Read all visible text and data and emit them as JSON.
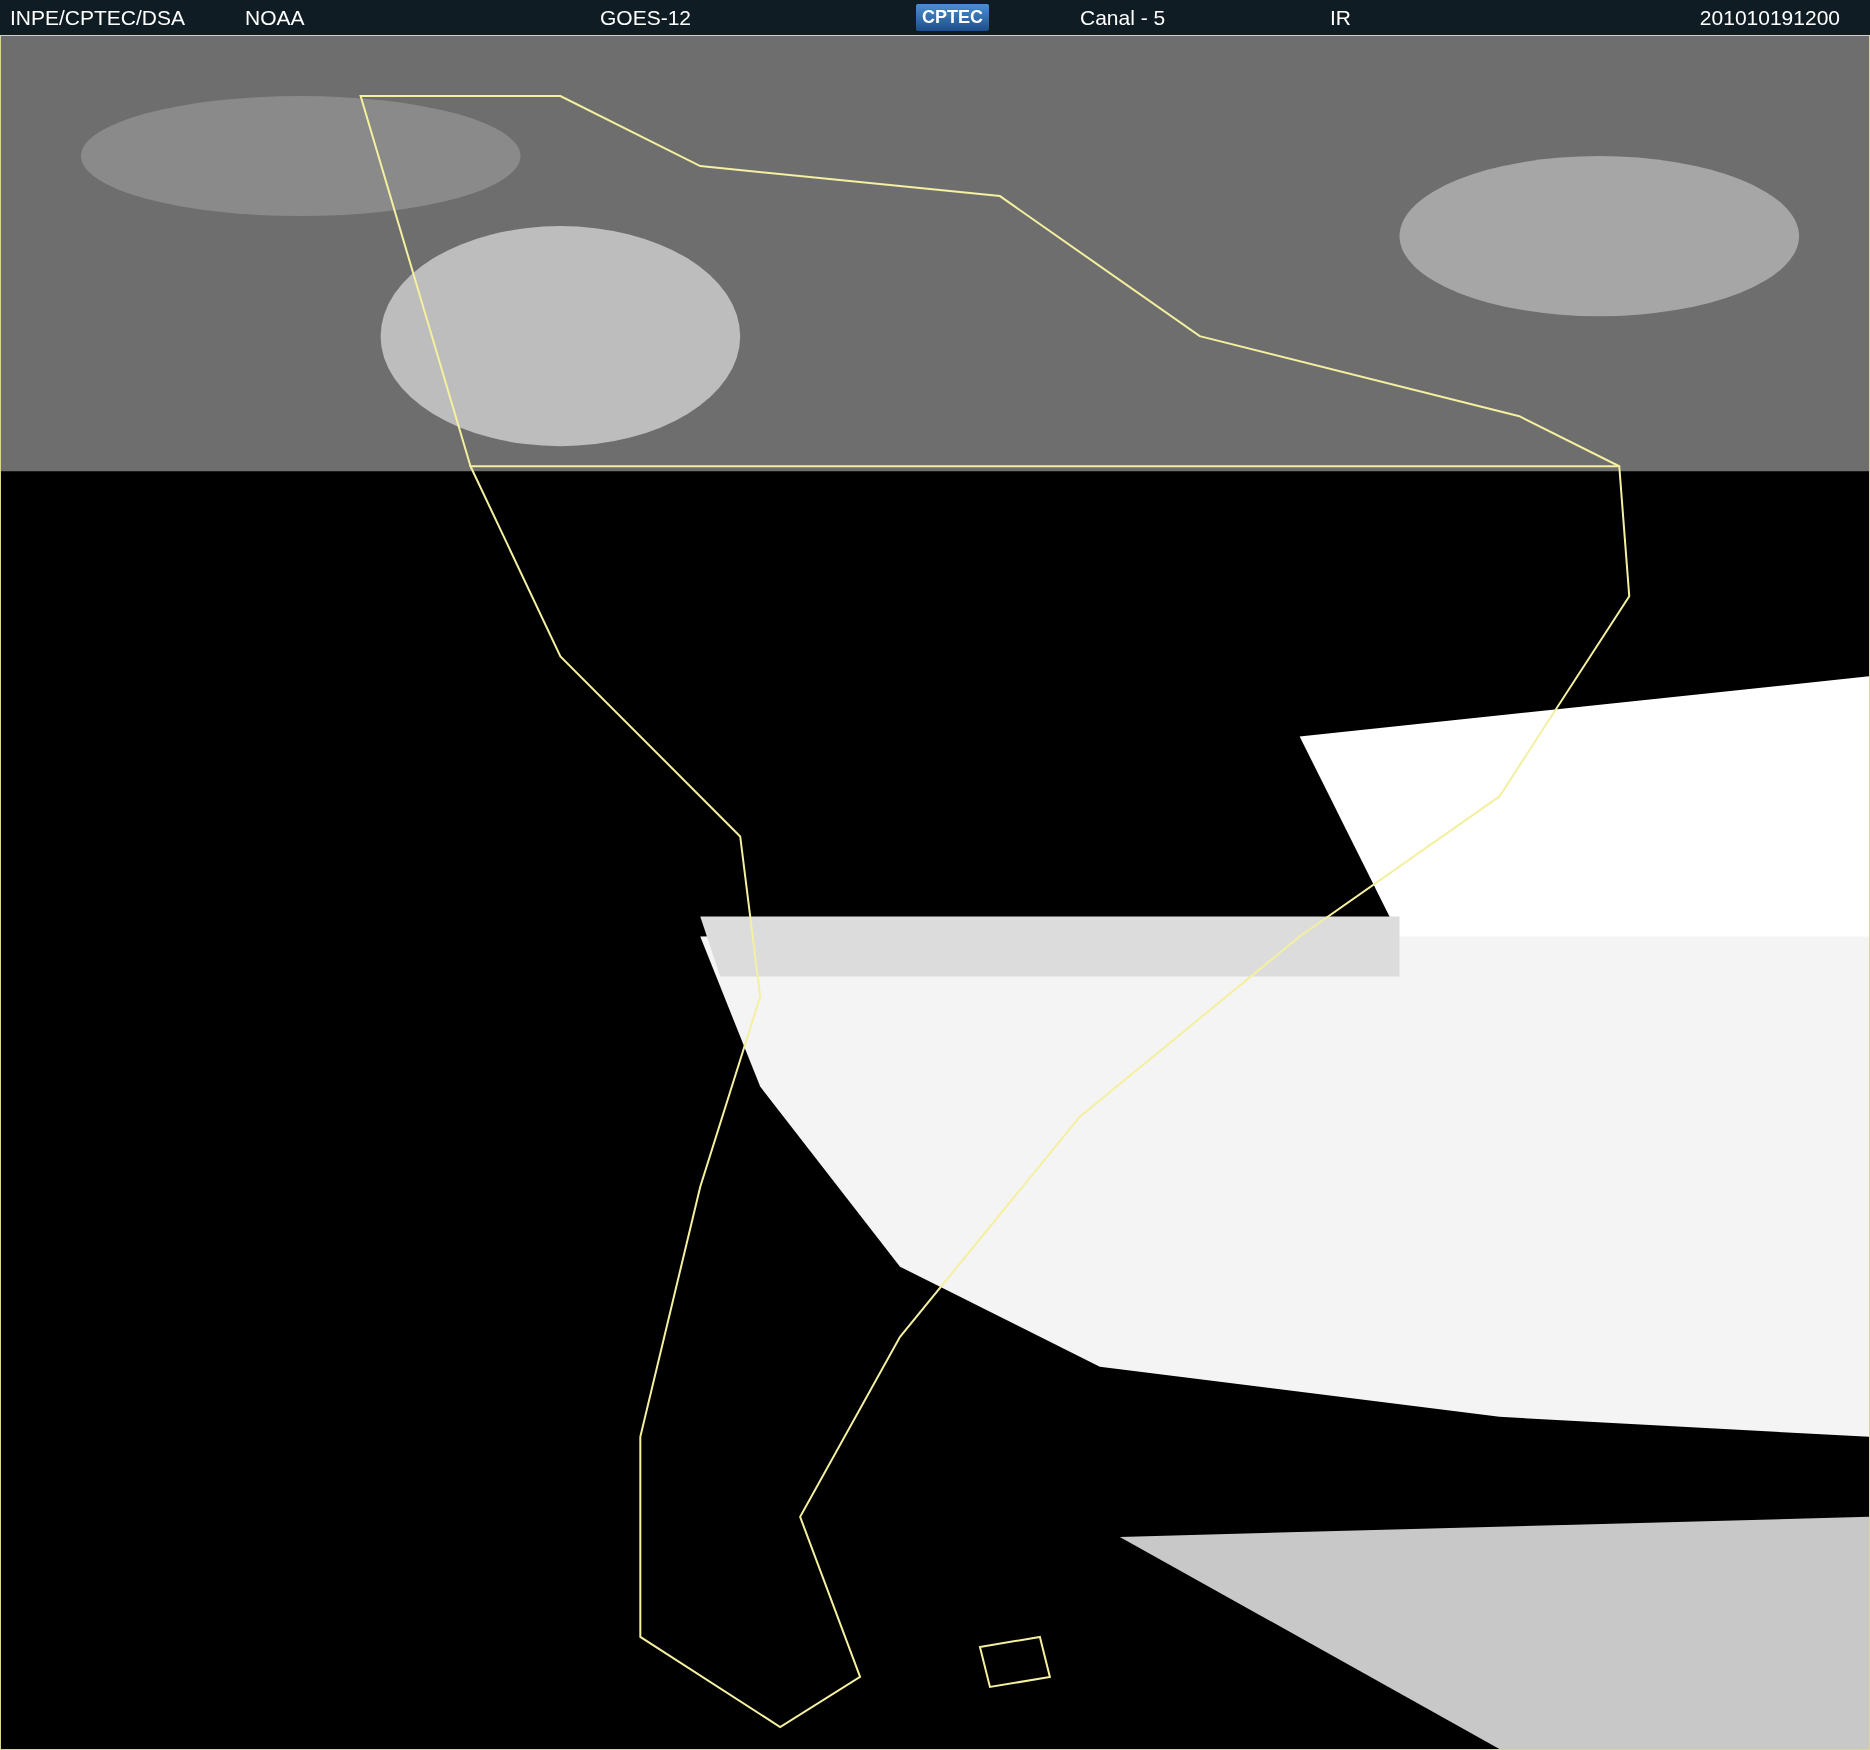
{
  "header": {
    "items": [
      {
        "kind": "text",
        "text": "INPE/CPTEC/DSA"
      },
      {
        "kind": "text",
        "text": "NOAA"
      },
      {
        "kind": "text",
        "text": "GOES-12"
      },
      {
        "kind": "logo",
        "text": "CPTEC"
      },
      {
        "kind": "text",
        "text": "Canal - 5"
      },
      {
        "kind": "text",
        "text": "IR"
      },
      {
        "kind": "text",
        "text": "201010191200"
      }
    ]
  }
}
